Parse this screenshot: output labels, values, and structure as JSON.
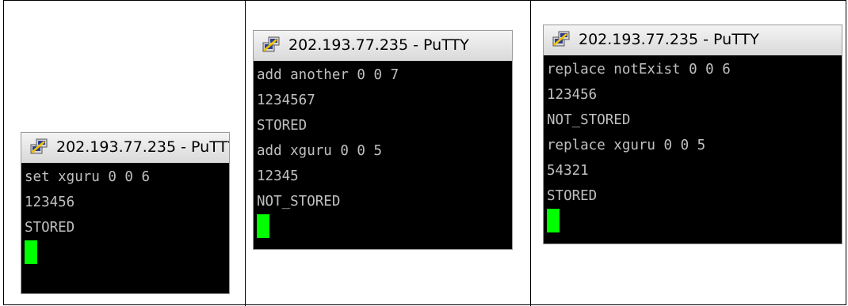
{
  "windows": [
    {
      "title": "202.193.77.235 - PuTTY",
      "lines": [
        "set xguru 0 0 6",
        "123456",
        "STORED"
      ]
    },
    {
      "title": "202.193.77.235 - PuTTY",
      "lines": [
        "add another 0 0 7",
        "1234567",
        "STORED",
        "add xguru 0 0 5",
        "12345",
        "NOT_STORED"
      ]
    },
    {
      "title": "202.193.77.235 - PuTTY",
      "lines": [
        "replace notExist 0 0 6",
        "123456",
        "NOT_STORED",
        "replace xguru 0 0 5",
        "54321",
        "STORED"
      ]
    }
  ],
  "colors": {
    "terminal_bg": "#000000",
    "terminal_text": "#c0c0c0",
    "cursor": "#00ff00"
  },
  "icons": [
    "putty-icon"
  ]
}
